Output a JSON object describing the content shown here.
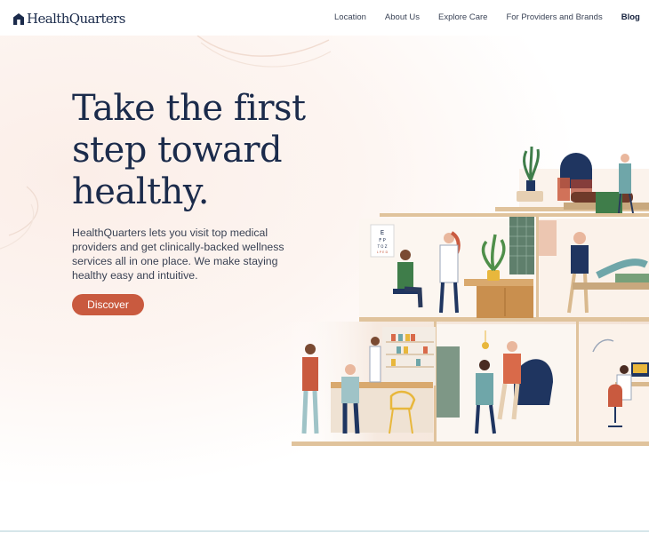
{
  "brand": {
    "name": "HealthQuarters"
  },
  "nav": {
    "items": [
      "Location",
      "About Us",
      "Explore Care",
      "For Providers and Brands"
    ],
    "active": "Blog"
  },
  "hero": {
    "headline_lines": [
      "Take the first",
      "step toward",
      "healthy."
    ],
    "subtext": "HealthQuarters lets you visit top medical providers and get clinically-backed wellness services all in one place. We make staying healthy easy and intuitive.",
    "cta_label": "Discover"
  },
  "illustration": {
    "eye_chart": [
      "E",
      "F P",
      "T O Z",
      "L P E D"
    ]
  },
  "colors": {
    "accent": "#c95a3f",
    "navy": "#1b2b4b",
    "blush": "#fbeee8",
    "wood": "#d9b98e"
  }
}
